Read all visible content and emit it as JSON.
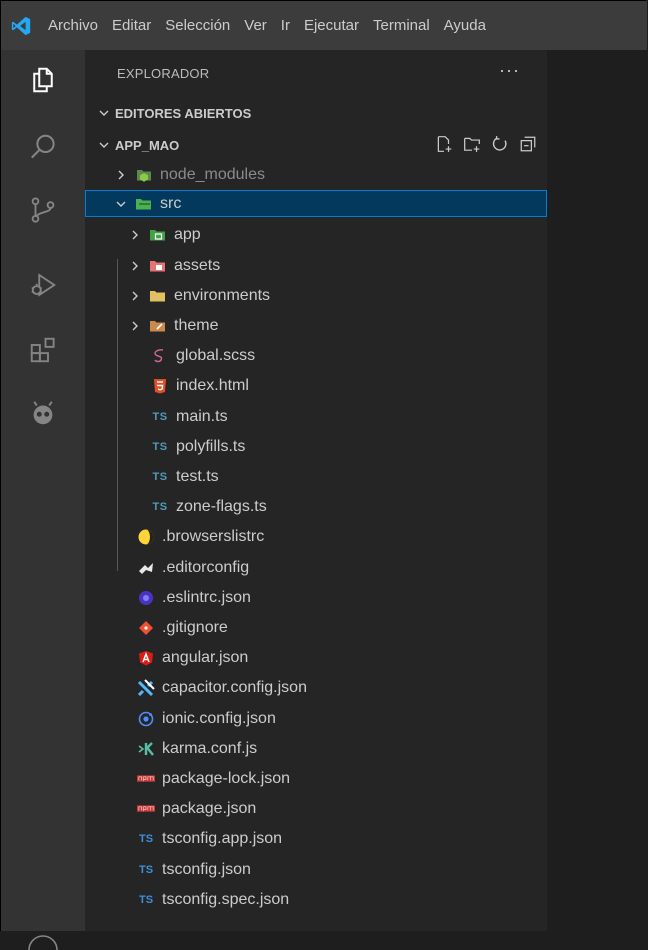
{
  "menu": [
    "Archivo",
    "Editar",
    "Selección",
    "Ver",
    "Ir",
    "Ejecutar",
    "Terminal",
    "Ayuda"
  ],
  "explorer": {
    "title": "EXPLORADOR",
    "more": "···",
    "open_editors": "EDITORES ABIERTOS",
    "project": "APP_MAO"
  },
  "tree": [
    {
      "label": "node_modules",
      "icon": "node-folder-icon",
      "kind": "folder-collapsed",
      "depth": 1,
      "dim": true
    },
    {
      "label": "src",
      "icon": "src-folder-icon",
      "kind": "folder-expanded",
      "depth": 1,
      "selected": true
    },
    {
      "label": "app",
      "icon": "app-folder-icon",
      "kind": "folder-collapsed",
      "depth": 2
    },
    {
      "label": "assets",
      "icon": "assets-folder-icon",
      "kind": "folder-collapsed",
      "depth": 2
    },
    {
      "label": "environments",
      "icon": "folder-icon",
      "kind": "folder-collapsed",
      "depth": 2
    },
    {
      "label": "theme",
      "icon": "theme-folder-icon",
      "kind": "folder-collapsed",
      "depth": 2
    },
    {
      "label": "global.scss",
      "icon": "sass-icon",
      "kind": "file",
      "depth": 2
    },
    {
      "label": "index.html",
      "icon": "html5-icon",
      "kind": "file",
      "depth": 2
    },
    {
      "label": "main.ts",
      "icon": "typescript-icon",
      "kind": "file",
      "depth": 2
    },
    {
      "label": "polyfills.ts",
      "icon": "typescript-icon",
      "kind": "file",
      "depth": 2
    },
    {
      "label": "test.ts",
      "icon": "typescript-icon",
      "kind": "file",
      "depth": 2
    },
    {
      "label": "zone-flags.ts",
      "icon": "typescript-icon",
      "kind": "file",
      "depth": 2
    },
    {
      "label": ".browserslistrc",
      "icon": "browserslist-icon",
      "kind": "file",
      "depth": 1
    },
    {
      "label": ".editorconfig",
      "icon": "editorconfig-icon",
      "kind": "file",
      "depth": 1
    },
    {
      "label": ".eslintrc.json",
      "icon": "eslint-icon",
      "kind": "file",
      "depth": 1
    },
    {
      "label": ".gitignore",
      "icon": "git-icon",
      "kind": "file",
      "depth": 1
    },
    {
      "label": "angular.json",
      "icon": "angular-icon",
      "kind": "file",
      "depth": 1
    },
    {
      "label": "capacitor.config.json",
      "icon": "capacitor-icon",
      "kind": "file",
      "depth": 1
    },
    {
      "label": "ionic.config.json",
      "icon": "ionic-icon",
      "kind": "file",
      "depth": 1
    },
    {
      "label": "karma.conf.js",
      "icon": "karma-icon",
      "kind": "file",
      "depth": 1
    },
    {
      "label": "package-lock.json",
      "icon": "npm-icon",
      "kind": "file",
      "depth": 1
    },
    {
      "label": "package.json",
      "icon": "npm-icon",
      "kind": "file",
      "depth": 1
    },
    {
      "label": "tsconfig.app.json",
      "icon": "tsconfig-icon",
      "kind": "file",
      "depth": 1
    },
    {
      "label": "tsconfig.json",
      "icon": "tsconfig-icon",
      "kind": "file",
      "depth": 1
    },
    {
      "label": "tsconfig.spec.json",
      "icon": "tsconfig-icon",
      "kind": "file",
      "depth": 1
    }
  ],
  "icon_text": {
    "ts": "TS",
    "tsconfig": "TS"
  },
  "colors": {
    "titlebar": "#3c3c3c",
    "activitybar": "#333333",
    "sidebar": "#252526",
    "selection": "#04395e",
    "focus": "#007fd4",
    "vscode_blue": "#23a9f2"
  }
}
